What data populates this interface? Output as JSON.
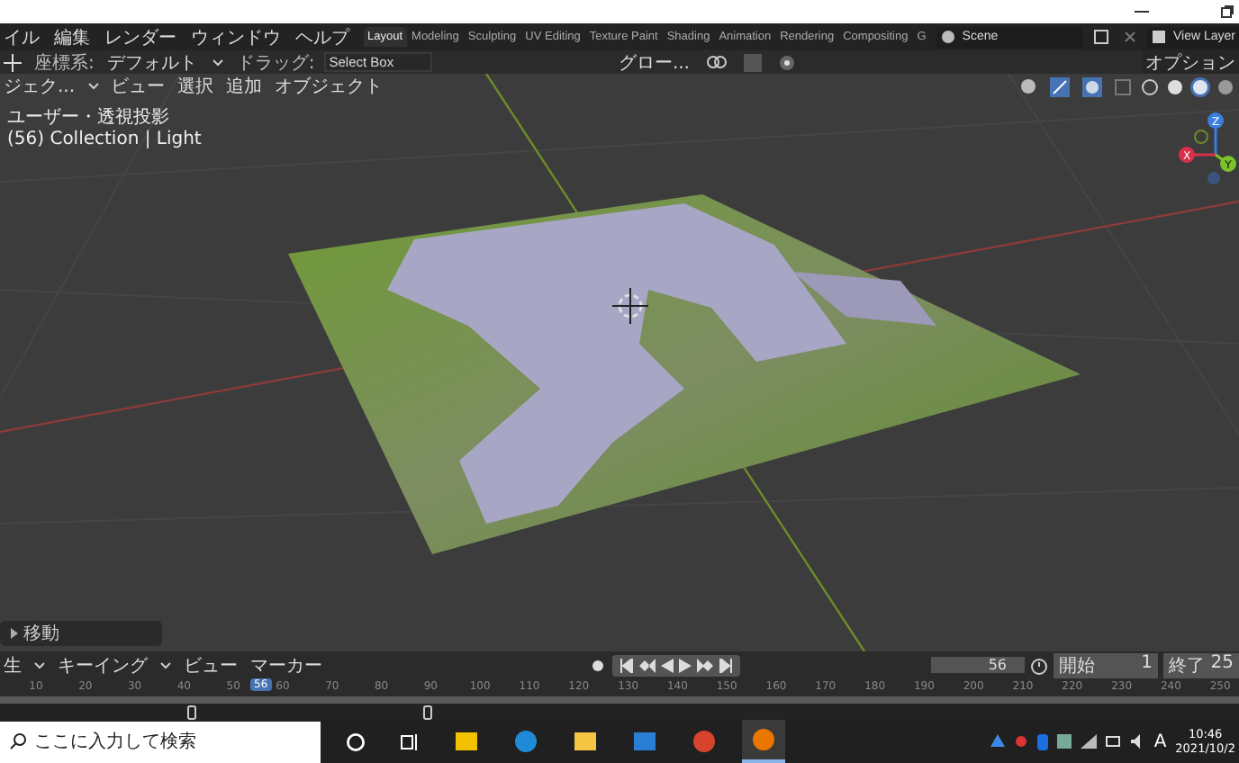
{
  "menu": [
    "イル",
    "編集",
    "レンダー",
    "ウィンドウ",
    "ヘルプ"
  ],
  "workspaces": [
    {
      "label": "Layout",
      "selected": true
    },
    {
      "label": "Modeling",
      "selected": false
    },
    {
      "label": "Sculpting",
      "selected": false
    },
    {
      "label": "UV Editing",
      "selected": false
    },
    {
      "label": "Texture Paint",
      "selected": false
    },
    {
      "label": "Shading",
      "selected": false
    },
    {
      "label": "Animation",
      "selected": false
    },
    {
      "label": "Rendering",
      "selected": false
    },
    {
      "label": "Compositing",
      "selected": false
    },
    {
      "label": "G",
      "selected": false
    }
  ],
  "scene": "Scene",
  "view_layer": "View Layer",
  "tool_header": {
    "orientation_label": "座標系:",
    "orientation": "デフォルト",
    "drag_label": "ドラッグ:",
    "drag": "Select Box",
    "transform_orientation": "グロー...",
    "options": "オプション"
  },
  "viewport_header": {
    "mode": "ジェク...",
    "menus": [
      "ビュー",
      "選択",
      "追加",
      "オブジェクト"
    ],
    "shading_modes": [
      {
        "kind": "wireframe",
        "selected": false
      },
      {
        "kind": "solid",
        "selected": false
      },
      {
        "kind": "material",
        "selected": true
      },
      {
        "kind": "rendered",
        "selected": false
      }
    ]
  },
  "viewport": {
    "view_name": "ユーザー・透視投影",
    "collection_info": "(56) Collection | Light",
    "operator_panel": "移動",
    "gizmo_axes": [
      "Z",
      "Y",
      "X"
    ]
  },
  "timeline": {
    "menus": [
      {
        "label": "生",
        "dropdown": true
      },
      {
        "label": "キーイング",
        "dropdown": true
      },
      {
        "label": "ビュー",
        "dropdown": false
      },
      {
        "label": "マーカー",
        "dropdown": false
      }
    ],
    "current_frame": "56",
    "start_label": "開始",
    "start": "1",
    "end_label": "終了",
    "end": "25",
    "ruler": [
      "10",
      "20",
      "30",
      "40",
      "50",
      "60",
      "70",
      "80",
      "90",
      "100",
      "110",
      "120",
      "130",
      "140",
      "150",
      "160",
      "170",
      "180",
      "190",
      "200",
      "210",
      "220",
      "230",
      "240",
      "250"
    ],
    "ruler_current": "56"
  },
  "taskbar": {
    "search_placeholder": "ここに入力して検索",
    "apps": [
      {
        "kind": "store",
        "active": false
      },
      {
        "kind": "edge",
        "active": false
      },
      {
        "kind": "explorer",
        "active": false
      },
      {
        "kind": "mail",
        "active": false
      },
      {
        "kind": "chrome",
        "active": false
      },
      {
        "kind": "blender",
        "active": true
      }
    ],
    "ime": "A",
    "time": "10:46",
    "date": "2021/10/2"
  }
}
